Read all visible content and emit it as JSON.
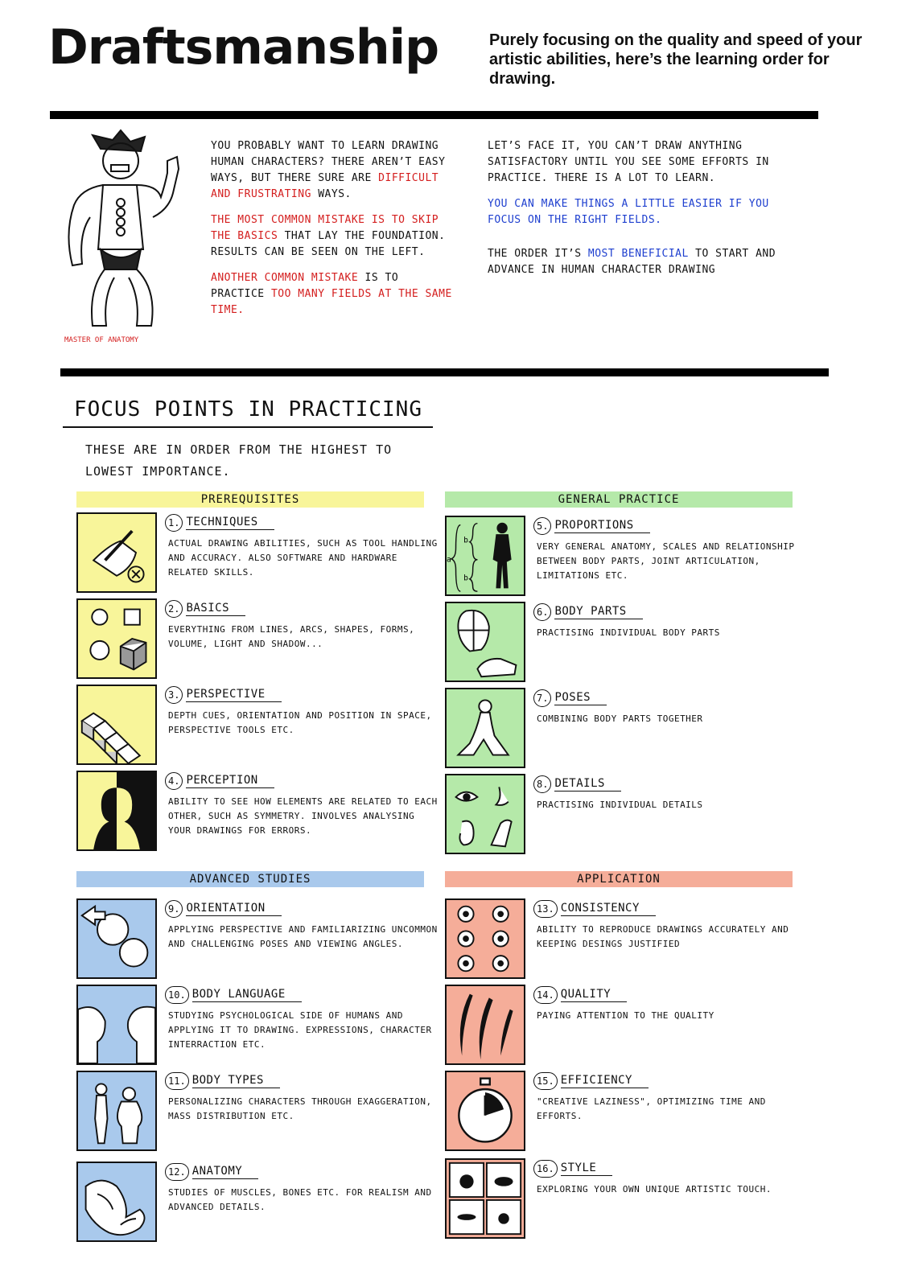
{
  "header": {
    "title": "Draftsmanship",
    "subtitle": "Purely focusing on the quality and speed of your artistic abilities, here’s the learning order for drawing."
  },
  "intro": {
    "figure_label": "MASTER OF ANATOMY",
    "left": {
      "p1_a": "YOU PROBABLY WANT TO LEARN DRAWING HUMAN CHARACTERS? THERE AREN’T EASY WAYS, BUT THERE SURE ARE",
      "p1_b": "DIFFICULT AND FRUSTRATING",
      "p1_c": "WAYS.",
      "p2_a": "THE MOST COMMON MISTAKE IS TO SKIP THE BASICS",
      "p2_b": "THAT LAY THE FOUNDATION. RESULTS CAN BE SEEN ON THE LEFT.",
      "p3_a": "ANOTHER COMMON MISTAKE",
      "p3_b": "IS TO PRACTICE",
      "p3_c": "TOO MANY FIELDS AT THE SAME TIME."
    },
    "right": {
      "p1": "LET’S FACE IT, YOU CAN’T DRAW ANYTHING SATISFACTORY UNTIL YOU SEE SOME EFFORTS IN PRACTICE. THERE IS A LOT TO LEARN.",
      "p2": "YOU CAN MAKE THINGS A LITTLE EASIER IF YOU FOCUS ON THE RIGHT FIELDS.",
      "p3_a": "THE ORDER IT’S",
      "p3_b": "MOST BENEFICIAL",
      "p3_c": "TO START AND ADVANCE IN HUMAN CHARACTER DRAWING"
    }
  },
  "focus": {
    "heading": "FOCUS POINTS IN PRACTICING",
    "sub": "THESE ARE IN ORDER FROM THE HIGHEST TO LOWEST IMPORTANCE."
  },
  "sections": {
    "prerequisites": "PREREQUISITES",
    "general": "GENERAL PRACTICE",
    "advanced": "ADVANCED STUDIES",
    "application": "APPLICATION"
  },
  "items": [
    {
      "num": "1.",
      "title": "TECHNIQUES",
      "desc": "ACTUAL DRAWING ABILITIES, SUCH AS TOOL HANDLING AND ACCURACY. ALSO SOFTWARE AND HARDWARE RELATED SKILLS."
    },
    {
      "num": "2.",
      "title": "BASICS",
      "desc": "EVERYTHING FROM LINES, ARCS, SHAPES, FORMS, VOLUME, LIGHT AND SHADOW..."
    },
    {
      "num": "3.",
      "title": "PERSPECTIVE",
      "desc": "DEPTH CUES, ORIENTATION AND POSITION IN SPACE, PERSPECTIVE TOOLS ETC."
    },
    {
      "num": "4.",
      "title": "PERCEPTION",
      "desc": "ABILITY TO SEE HOW ELEMENTS ARE RELATED TO EACH OTHER, SUCH AS SYMMETRY. INVOLVES ANALYSING YOUR DRAWINGS FOR ERRORS."
    },
    {
      "num": "5.",
      "title": "PROPORTIONS",
      "desc": "VERY GENERAL ANATOMY, SCALES AND RELATIONSHIP BETWEEN BODY PARTS, JOINT ARTICULATION, LIMITATIONS ETC."
    },
    {
      "num": "6.",
      "title": "BODY PARTS",
      "desc": "PRACTISING INDIVIDUAL BODY PARTS"
    },
    {
      "num": "7.",
      "title": "POSES",
      "desc": "COMBINING BODY PARTS TOGETHER"
    },
    {
      "num": "8.",
      "title": "DETAILS",
      "desc": "PRACTISING INDIVIDUAL DETAILS"
    },
    {
      "num": "9.",
      "title": "ORIENTATION",
      "desc": "APPLYING PERSPECTIVE AND FAMILIARIZING UNCOMMON AND CHALLENGING POSES AND VIEWING ANGLES."
    },
    {
      "num": "10.",
      "title": "BODY LANGUAGE",
      "desc": "STUDYING PSYCHOLOGICAL SIDE OF HUMANS AND APPLYING IT TO DRAWING. EXPRESSIONS, CHARACTER INTERRACTION ETC."
    },
    {
      "num": "11.",
      "title": "BODY TYPES",
      "desc": "PERSONALIZING CHARACTERS THROUGH EXAGGERATION, MASS DISTRIBUTION ETC."
    },
    {
      "num": "12.",
      "title": "ANATOMY",
      "desc": "STUDIES OF MUSCLES, BONES ETC. FOR REALISM AND ADVANCED DETAILS."
    },
    {
      "num": "13.",
      "title": "CONSISTENCY",
      "desc": "ABILITY TO REPRODUCE DRAWINGS ACCURATELY AND KEEPING DESINGS JUSTIFIED"
    },
    {
      "num": "14.",
      "title": "QUALITY",
      "desc": "PAYING ATTENTION TO THE QUALITY"
    },
    {
      "num": "15.",
      "title": "EFFICIENCY",
      "desc": "\"CREATIVE LAZINESS\", OPTIMIZING TIME AND EFFORTS."
    },
    {
      "num": "16.",
      "title": "STYLE",
      "desc": "EXPLORING YOUR OWN UNIQUE ARTISTIC TOUCH."
    }
  ],
  "colors": {
    "prerequisites": "#f8f59a",
    "general": "#b5e9a9",
    "advanced": "#a9c9ec",
    "application": "#f5ad99",
    "red_text": "#d41e1e",
    "blue_text": "#1e3fcf"
  }
}
